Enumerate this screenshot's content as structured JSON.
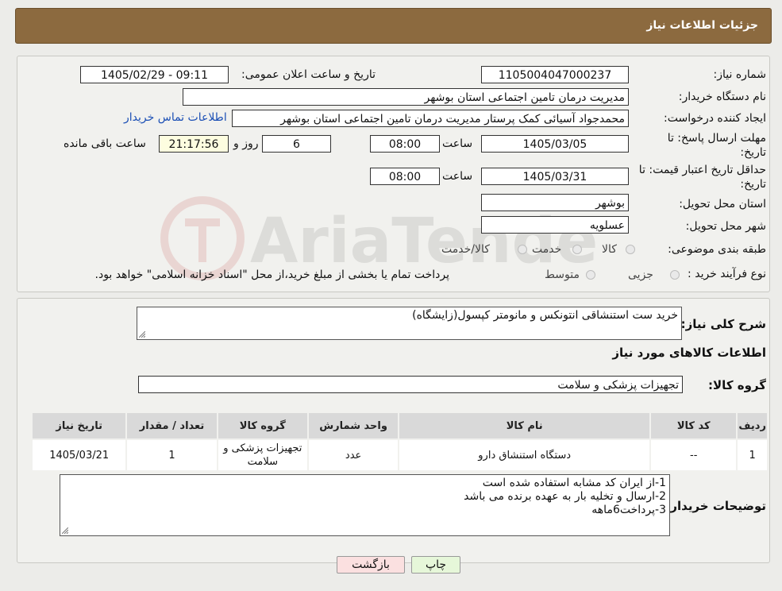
{
  "header": {
    "title": "جزئیات اطلاعات نیاز"
  },
  "form": {
    "need_number_label": "شماره نیاز:",
    "need_number": "1105004047000237",
    "announce_label": "تاریخ و ساعت اعلان عمومی:",
    "announce_value": "1405/02/29 - 09:11",
    "buyer_org_label": "نام دستگاه خریدار:",
    "buyer_org": "مدیریت درمان تامین اجتماعی استان بوشهر",
    "creator_label": "ایجاد کننده درخواست:",
    "creator": "محمدجواد آسیائی کمک پرستار مدیریت درمان تامین اجتماعی استان بوشهر",
    "contact_link": "اطلاعات تماس خریدار",
    "deadline_label_1": "مهلت ارسال پاسخ: تا",
    "deadline_label_2": "تاریخ:",
    "deadline_date": "1405/03/05",
    "time_label": "ساعت",
    "deadline_time": "08:00",
    "days_value": "6",
    "days_label": "روز و",
    "remaining_time": "21:17:56",
    "remaining_label": "ساعت باقی مانده",
    "validity_label_1": "حداقل تاریخ اعتبار قیمت: تا",
    "validity_label_2": "تاریخ:",
    "validity_date": "1405/03/31",
    "validity_time": "08:00",
    "province_label": "استان محل تحویل:",
    "province": "بوشهر",
    "city_label": "شهر محل تحویل:",
    "city": "عسلویه",
    "category_label": "طبقه بندی موضوعی:",
    "category_options": [
      "کالا",
      "خدمت",
      "کالا/خدمت"
    ],
    "process_label": "نوع فرآیند خرید :",
    "process_options": [
      "جزیی",
      "متوسط"
    ],
    "process_note": "پرداخت تمام یا بخشی از مبلغ خرید،از محل \"اسناد خزانه اسلامی\" خواهد بود."
  },
  "need": {
    "summary_label": "شرح کلی نیاز:",
    "summary": "خرید ست استنشاقی انتونکس و مانومتر کپسول(زایشگاه)",
    "goods_info_title": "اطلاعات کالاهای مورد نیاز",
    "goods_group_label": "گروه کالا:",
    "goods_group": "تجهیزات پزشکی و سلامت"
  },
  "table": {
    "headers": [
      "ردیف",
      "کد کالا",
      "نام کالا",
      "واحد شمارش",
      "گروه کالا",
      "تعداد / مقدار",
      "تاریخ نیاز"
    ],
    "rows": [
      {
        "row": "1",
        "code": "--",
        "name": "دستگاه استنشاق دارو",
        "unit": "عدد",
        "group": "تجهیزات پزشکی و سلامت",
        "qty": "1",
        "date": "1405/03/21"
      }
    ]
  },
  "notes": {
    "label": "توضیحات خریدار:",
    "lines": [
      "1-از ایران کد مشابه استفاده شده است",
      "2-ارسال و تخلیه بار به عهده برنده می باشد",
      "3-پرداخت6ماهه"
    ]
  },
  "buttons": {
    "print": "چاپ",
    "back": "بازگشت"
  },
  "watermark": {
    "text": "AriaTender.neT"
  }
}
